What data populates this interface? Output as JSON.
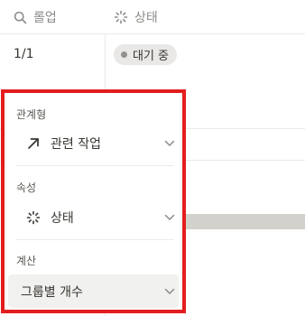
{
  "table": {
    "headers": {
      "rollup": "롤업",
      "status": "상태"
    },
    "row": {
      "rollup_value": "1/1",
      "status_value": "대기 중"
    }
  },
  "panel": {
    "relation": {
      "label": "관계형",
      "value": "관련 작업"
    },
    "property": {
      "label": "속성",
      "value": "상태"
    },
    "calculate": {
      "label": "계산",
      "value": "그룹별 개수"
    }
  },
  "colors": {
    "highlight_border": "#e31d1d",
    "status_pill_bg": "#e9e8e6",
    "status_dot": "#91918e"
  },
  "icons": {
    "rollup_header": "search-icon",
    "status_header": "status-loader-icon",
    "relation": "arrow-up-right-icon",
    "property": "status-loader-icon",
    "dropdown": "chevron-down-icon"
  }
}
